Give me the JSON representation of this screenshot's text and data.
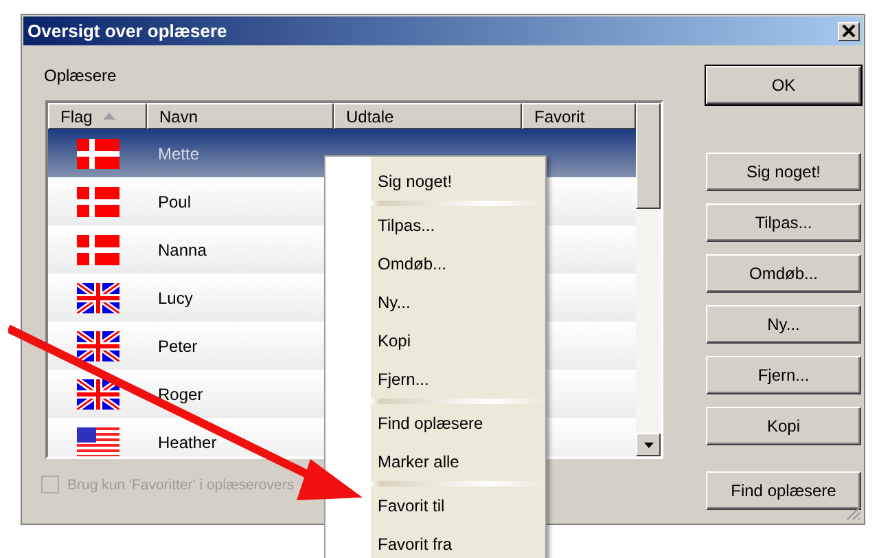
{
  "window": {
    "title": "Oversigt over oplæsere"
  },
  "group_label": "Oplæsere",
  "table": {
    "columns": [
      {
        "label": "Flag",
        "sorted": true
      },
      {
        "label": "Navn",
        "sorted": false
      },
      {
        "label": "Udtale",
        "sorted": false
      },
      {
        "label": "Favorit",
        "sorted": false
      }
    ],
    "rows": [
      {
        "kind": "dk",
        "name": "Mette",
        "selected": true
      },
      {
        "kind": "dk",
        "name": "Poul",
        "selected": false
      },
      {
        "kind": "dk",
        "name": "Nanna",
        "selected": false
      },
      {
        "kind": "gb",
        "name": "Lucy",
        "selected": false
      },
      {
        "kind": "gb",
        "name": "Peter",
        "selected": false
      },
      {
        "kind": "gb",
        "name": "Roger",
        "selected": false
      },
      {
        "kind": "us",
        "name": "Heather",
        "selected": false
      }
    ]
  },
  "checkbox": {
    "label": "Brug kun 'Favoritter' i oplæserovers",
    "checked": false,
    "disabled": true
  },
  "buttons": [
    {
      "label": "OK",
      "kind": "default"
    },
    {
      "label": "Sig noget!",
      "kind": "normal"
    },
    {
      "label": "Tilpas...",
      "kind": "normal"
    },
    {
      "label": "Omdøb...",
      "kind": "normal"
    },
    {
      "label": "Ny...",
      "kind": "normal"
    },
    {
      "label": "Fjern...",
      "kind": "normal"
    },
    {
      "label": "Kopi",
      "kind": "normal"
    },
    {
      "label": "Find oplæsere",
      "kind": "normal"
    }
  ],
  "context_menu": [
    {
      "kind": "item",
      "label": "Sig noget!"
    },
    {
      "kind": "separator"
    },
    {
      "kind": "item",
      "label": "Tilpas..."
    },
    {
      "kind": "item",
      "label": "Omdøb..."
    },
    {
      "kind": "item",
      "label": "Ny..."
    },
    {
      "kind": "item",
      "label": "Kopi"
    },
    {
      "kind": "item",
      "label": "Fjern..."
    },
    {
      "kind": "separator"
    },
    {
      "kind": "item",
      "label": "Find oplæsere"
    },
    {
      "kind": "item",
      "label": "Marker alle"
    },
    {
      "kind": "separator"
    },
    {
      "kind": "item",
      "label": "Favorit til"
    },
    {
      "kind": "item",
      "label": "Favorit fra"
    }
  ]
}
